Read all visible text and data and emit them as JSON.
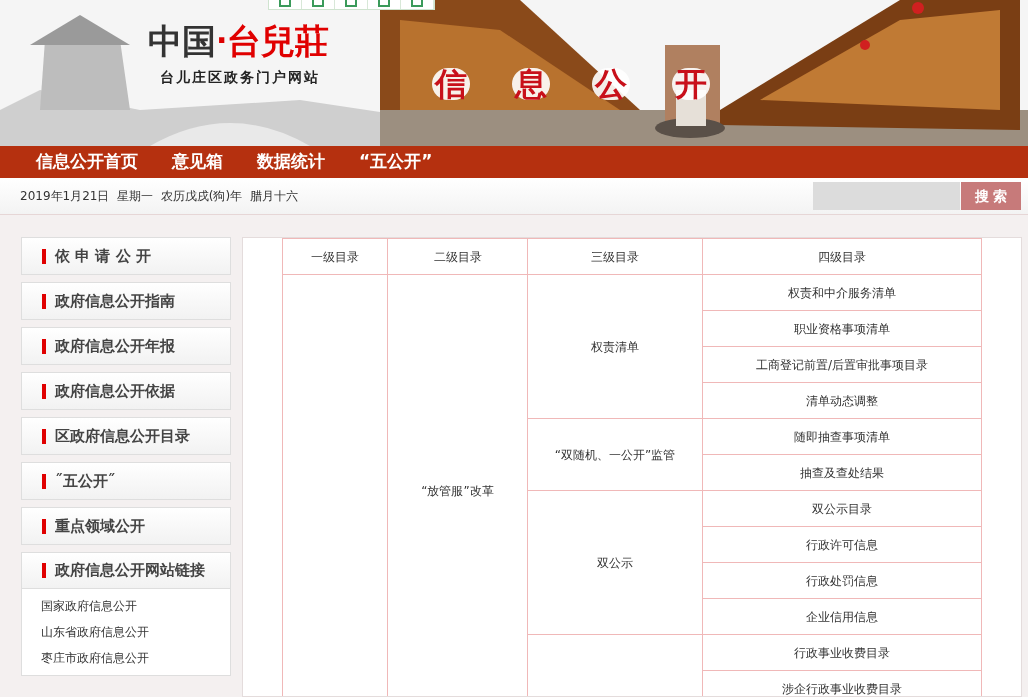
{
  "header": {
    "logo_part_1": "中国",
    "logo_dot": "·",
    "logo_part_2": "台兒莊",
    "subtitle": "台儿庄区政务门户网站",
    "banner_title": [
      "信",
      "息",
      "公",
      "开"
    ]
  },
  "nav": {
    "items": [
      "信息公开首页",
      "意见箱",
      "数据统计",
      "“五公开”"
    ]
  },
  "info_bar": {
    "date": "2019年1月21日  星期一  农历戊戌(狗)年  腊月十六",
    "search": {
      "button": "搜 索"
    }
  },
  "sidebar": {
    "items": [
      {
        "label": "依 申 请 公 开",
        "expanded": false
      },
      {
        "label": "政府信息公开指南",
        "expanded": false
      },
      {
        "label": "政府信息公开年报",
        "expanded": false
      },
      {
        "label": "政府信息公开依据",
        "expanded": false
      },
      {
        "label": "区政府信息公开目录",
        "expanded": false
      },
      {
        "label": "˝五公开˝",
        "expanded": false
      },
      {
        "label": "重点领域公开",
        "expanded": false
      },
      {
        "label": "政府信息公开网站链接",
        "expanded": true,
        "children": [
          "国家政府信息公开",
          "山东省政府信息公开",
          "枣庄市政府信息公开"
        ]
      }
    ]
  },
  "table": {
    "columns": [
      "一级目录",
      "二级目录",
      "三级目录",
      "四级目录"
    ],
    "groups": [
      {
        "level2": "“放管服”改革",
        "children": [
          {
            "name": "权责清单",
            "children": [
              "权责和中介服务清单",
              "职业资格事项清单",
              "工商登记前置/后置审批事项目录",
              "清单动态调整"
            ]
          },
          {
            "name": "“双随机、一公开”监管",
            "children": [
              "随即抽查事项清单",
              "抽查及查处结果"
            ]
          },
          {
            "name": "双公示",
            "children": [
              "双公示目录",
              "行政许可信息",
              "行政处罚信息",
              "企业信用信息"
            ]
          },
          {
            "children": [
              "行政事业收费目录",
              "涉企行政事业收费目录"
            ]
          }
        ]
      }
    ]
  }
}
